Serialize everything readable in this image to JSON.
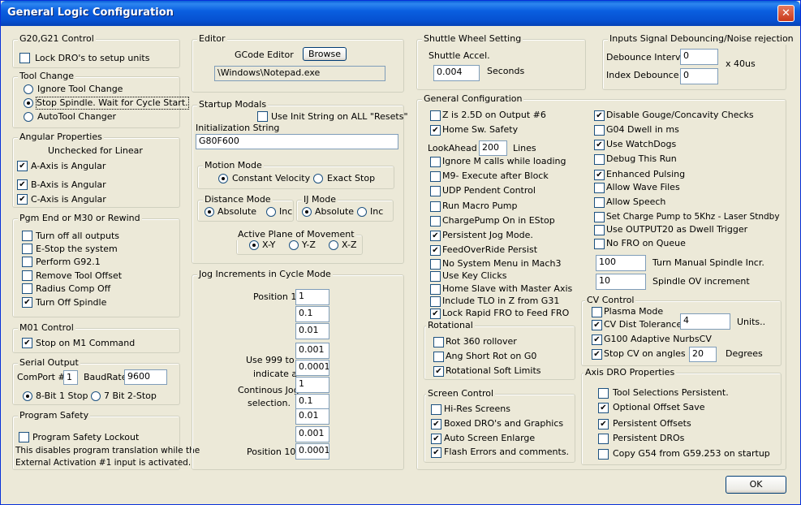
{
  "window": {
    "title": "General Logic Configuration",
    "close_glyph": "✕"
  },
  "g20": {
    "title": "G20,G21 Control",
    "lock": "Lock DRO's to setup units"
  },
  "tool": {
    "title": "Tool Change",
    "opt1": "Ignore Tool Change",
    "opt2": "Stop Spindle. Wait for Cycle Start.",
    "opt3": "AutoTool Changer"
  },
  "angular": {
    "title": "Angular Properties",
    "note": "Unchecked for Linear",
    "a": "A-Axis is Angular",
    "b": "B-Axis is Angular",
    "c": "C-Axis is Angular"
  },
  "pgmend": {
    "title": "Pgm End or M30 or Rewind",
    "items": [
      "Turn off all outputs",
      "E-Stop the system",
      "Perform G92.1",
      "Remove Tool Offset",
      "Radius Comp Off",
      "Turn Off Spindle"
    ]
  },
  "m01": {
    "title": "M01 Control",
    "stop": "Stop on M1 Command"
  },
  "serial": {
    "title": "Serial Output",
    "comport_label": "ComPort #",
    "comport": "1",
    "baud_label": "BaudRate",
    "baud": "9600",
    "opt1": "8-Bit 1 Stop",
    "opt2": "7 Bit 2-Stop"
  },
  "safety": {
    "title": "Program Safety",
    "lockout": "Program Safety Lockout",
    "desc1": "This disables program translation while the",
    "desc2": "External Activation #1 input is activated."
  },
  "editor": {
    "title": "Editor",
    "label": "GCode Editor",
    "browse": "Browse",
    "path": "\\Windows\\Notepad.exe"
  },
  "startup": {
    "title": "Startup Modals",
    "use_init": "Use Init String on ALL  \"Resets\"",
    "init_label": "Initialization String",
    "init_value": "G80F600",
    "motion": {
      "title": "Motion Mode",
      "cv": "Constant Velocity",
      "es": "Exact Stop"
    },
    "distance": {
      "title": "Distance Mode",
      "abs": "Absolute",
      "inc": "Inc"
    },
    "ij": {
      "title": "IJ Mode",
      "abs": "Absolute",
      "inc": "Inc"
    },
    "plane": {
      "title": "Active Plane of Movement",
      "xy": "X-Y",
      "yz": "Y-Z",
      "xz": "X-Z"
    }
  },
  "jog": {
    "title": "Jog Increments in Cycle Mode",
    "pos1": "Position 1",
    "pos10": "Position 10",
    "note1": "Use 999 to",
    "note2": "indicate a",
    "note3": "Continous Jog",
    "note4": "selection.",
    "values": [
      "1",
      "0.1",
      "0.01",
      "0.001",
      "0.0001",
      "1",
      "0.1",
      "0.01",
      "0.001",
      "0.0001"
    ]
  },
  "shuttle": {
    "title": "Shuttle Wheel Setting",
    "accel": "Shuttle Accel.",
    "value": "0.004",
    "unit": "Seconds"
  },
  "debounce": {
    "title": "Inputs Signal Debouncing/Noise rejection",
    "interval_label": "Debounce Interval",
    "interval": "0",
    "index_label": "Index Debounce",
    "index": "0",
    "unit": "x 40us"
  },
  "general": {
    "title": "General Configuration",
    "left": [
      {
        "label": "Z is 2.5D on Output #6",
        "checked": false
      },
      {
        "label": "Home Sw. Safety",
        "checked": true
      }
    ],
    "lookahead_label": "LookAhead",
    "lookahead": "200",
    "lookahead_unit": "Lines",
    "left2": [
      {
        "label": "Ignore M calls while loading",
        "checked": false
      },
      {
        "label": "M9- Execute after Block",
        "checked": false
      },
      {
        "label": "UDP Pendent Control",
        "checked": false
      },
      {
        "label": "Run Macro Pump",
        "checked": false
      },
      {
        "label": "ChargePump On in EStop",
        "checked": false
      },
      {
        "label": "Persistent Jog Mode.",
        "checked": true
      },
      {
        "label": "FeedOverRide Persist",
        "checked": true
      },
      {
        "label": "No System Menu in Mach3",
        "checked": false
      },
      {
        "label": "Use Key Clicks",
        "checked": false
      },
      {
        "label": "Home Slave with Master Axis",
        "checked": false
      },
      {
        "label": "Include TLO in Z from G31",
        "checked": false
      },
      {
        "label": "Lock Rapid FRO to Feed FRO",
        "checked": true
      }
    ],
    "right": [
      {
        "label": "Disable Gouge/Concavity Checks",
        "checked": true
      },
      {
        "label": "G04 Dwell in ms",
        "checked": false
      },
      {
        "label": "Use WatchDogs",
        "checked": true
      },
      {
        "label": "Debug This Run",
        "checked": false
      },
      {
        "label": "Enhanced Pulsing",
        "checked": true
      },
      {
        "label": "Allow Wave Files",
        "checked": false
      },
      {
        "label": "Allow Speech",
        "checked": false
      },
      {
        "label": "Set Charge Pump to 5Khz  - Laser Stndby",
        "checked": false
      },
      {
        "label": "Use OUTPUT20 as Dwell Trigger",
        "checked": false
      },
      {
        "label": "No FRO on Queue",
        "checked": false
      }
    ],
    "spindle_incr": "100",
    "spindle_incr_label": "Turn Manual Spindle Incr.",
    "spindle_ov": "10",
    "spindle_ov_label": "Spindle OV increment"
  },
  "rotational": {
    "title": "Rotational",
    "items": [
      {
        "label": "Rot 360 rollover",
        "checked": false
      },
      {
        "label": "Ang Short Rot on G0",
        "checked": false
      },
      {
        "label": "Rotational Soft Limits",
        "checked": true
      }
    ]
  },
  "screen": {
    "title": "Screen Control",
    "items": [
      {
        "label": "Hi-Res Screens",
        "checked": false
      },
      {
        "label": "Boxed DRO's and Graphics",
        "checked": true
      },
      {
        "label": "Auto Screen Enlarge",
        "checked": true
      },
      {
        "label": "Flash Errors and comments.",
        "checked": true
      }
    ]
  },
  "cv": {
    "title": "CV Control",
    "plasma": "Plasma Mode",
    "dist": "CV Dist Tolerance",
    "dist_value": "4",
    "dist_unit": "Units..",
    "g100": "G100 Adaptive NurbsCV",
    "stop": "Stop CV on angles >",
    "stop_value": "20",
    "stop_unit": "Degrees"
  },
  "axisdro": {
    "title": "Axis DRO Properties",
    "items": [
      {
        "label": "Tool Selections Persistent.",
        "checked": false
      },
      {
        "label": "Optional Offset Save",
        "checked": true
      },
      {
        "label": "Persistent Offsets",
        "checked": true
      },
      {
        "label": "Persistent DROs",
        "checked": false
      },
      {
        "label": "Copy G54 from G59.253 on startup",
        "checked": false
      }
    ]
  },
  "ok": "OK",
  "check_glyph": "✔"
}
